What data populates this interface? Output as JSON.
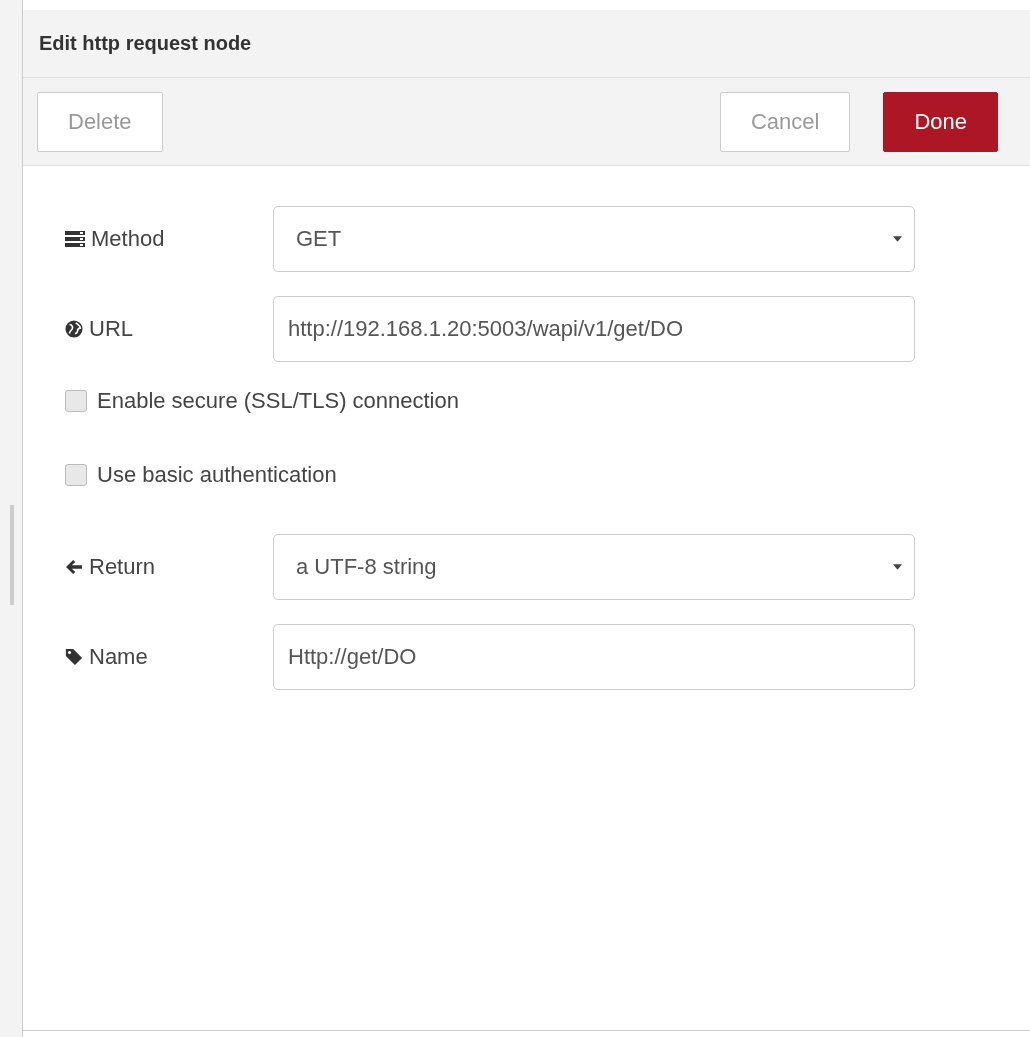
{
  "dialog": {
    "title": "Edit http request node"
  },
  "toolbar": {
    "left_buttons": [
      {
        "label": "Delete",
        "kind": "plain"
      }
    ],
    "right_buttons": [
      {
        "label": "Cancel",
        "kind": "plain"
      },
      {
        "label": "Done",
        "kind": "primary"
      }
    ]
  },
  "rows": [
    {
      "kind": "select",
      "label": "Method",
      "value": "GET"
    },
    {
      "kind": "input",
      "label": "URL",
      "value": "http://192.168.1.20:5003/wapi/v1/get/DO"
    },
    {
      "kind": "checkbox",
      "label": "Enable secure (SSL/TLS) connection",
      "checked": false
    },
    {
      "kind": "checkbox",
      "label": "Use basic authentication",
      "checked": false
    },
    {
      "kind": "select",
      "label": "Return",
      "value": "a UTF-8 string"
    },
    {
      "kind": "input",
      "label": "Name",
      "value": "Http://get/DO"
    }
  ]
}
